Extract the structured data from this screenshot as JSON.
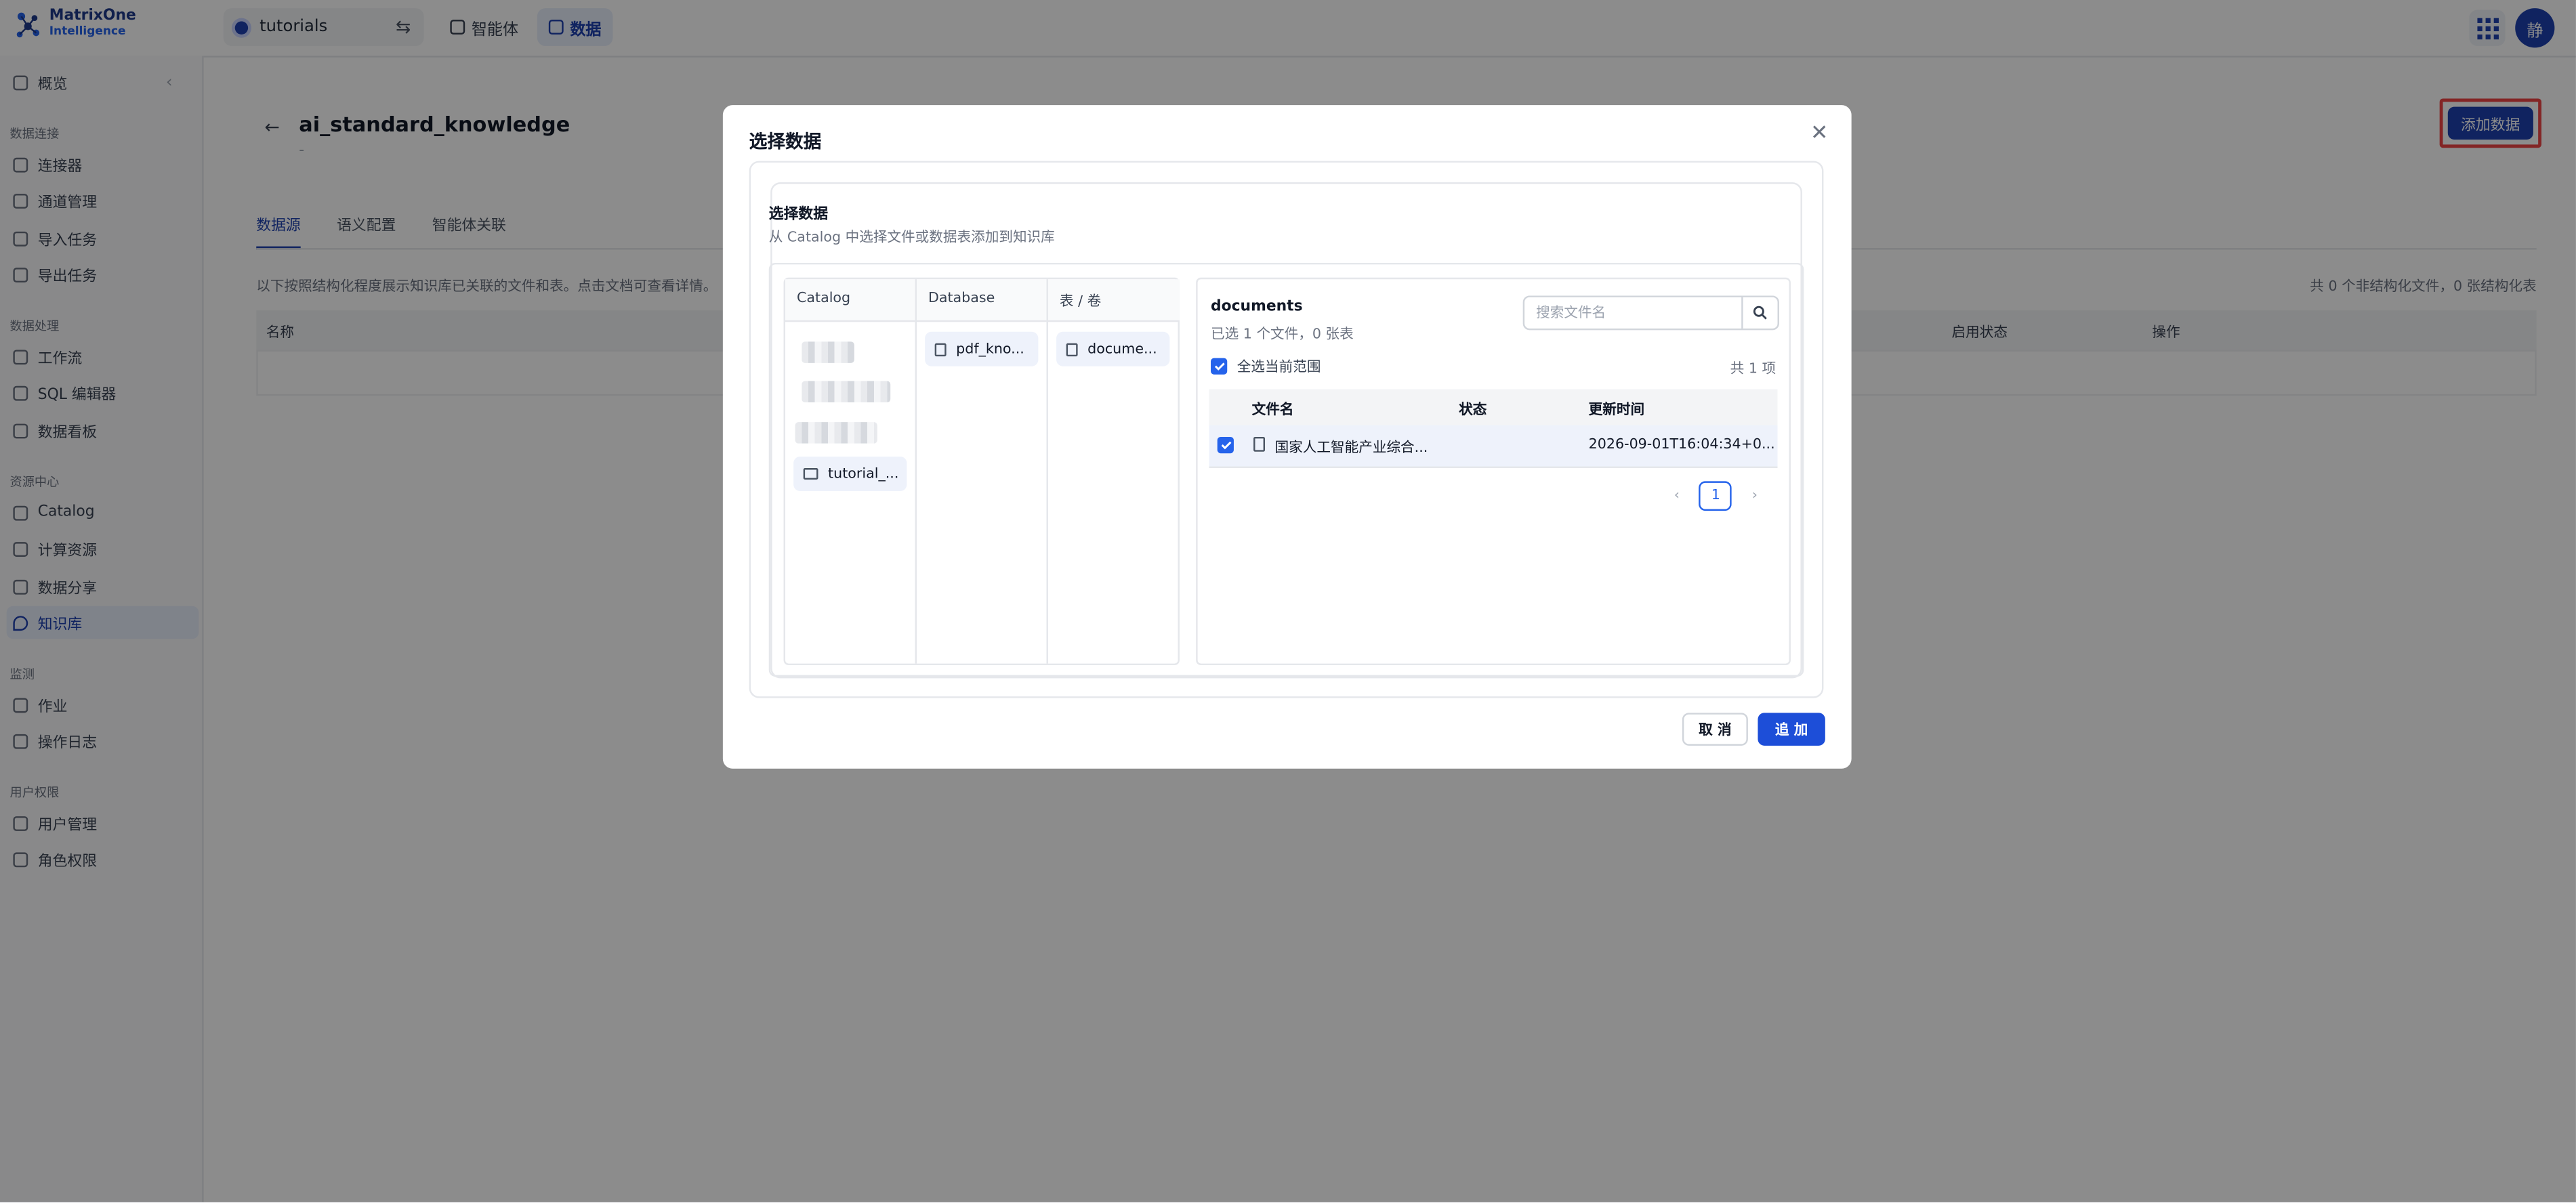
{
  "app": {
    "logo_line1": "MatrixOne",
    "logo_line2": "Intelligence",
    "avatar_initial": "静"
  },
  "topbar": {
    "workspace": "tutorials",
    "nav": [
      {
        "label": "智能体"
      },
      {
        "label": "数据"
      }
    ]
  },
  "sidebar": {
    "overview": "概览",
    "groups": [
      {
        "title": "数据连接",
        "items": [
          "连接器",
          "通道管理",
          "导入任务",
          "导出任务"
        ]
      },
      {
        "title": "数据处理",
        "items": [
          "工作流",
          "SQL 编辑器",
          "数据看板"
        ]
      },
      {
        "title": "资源中心",
        "items": [
          "Catalog",
          "计算资源",
          "数据分享",
          "知识库"
        ]
      },
      {
        "title": "监测",
        "items": [
          "作业",
          "操作日志"
        ]
      },
      {
        "title": "用户权限",
        "items": [
          "用户管理",
          "角色权限"
        ]
      }
    ],
    "active": "知识库"
  },
  "page": {
    "title": "ai_standard_knowledge",
    "subtitle": "-",
    "add_button": "添加数据",
    "tabs": [
      "数据源",
      "语义配置",
      "智能体关联"
    ],
    "description": "以下按照结构化程度展示知识库已关联的文件和表。点击文档可查看详情。",
    "count": "共 0 个非结构化文件，0 张结构化表",
    "table_headers": [
      "名称",
      "启用状态",
      "操作"
    ]
  },
  "modal": {
    "title": "选择数据",
    "section_title": "选择数据",
    "section_sub": "从 Catalog 中选择文件或数据表添加到知识库",
    "columns": {
      "catalog_header": "Catalog",
      "database_header": "Database",
      "table_header": "表 / 卷",
      "catalog_selected": "tutorial_...",
      "database_item": "pdf_kno...",
      "table_item": "docume..."
    },
    "right": {
      "title": "documents",
      "subtitle": "已选 1 个文件，0 张表",
      "search_placeholder": "搜索文件名",
      "select_all": "全选当前范围",
      "total": "共 1 项",
      "headers": [
        "文件名",
        "状态",
        "更新时间"
      ],
      "rows": [
        {
          "name": "国家人工智能产业综合...",
          "status": "",
          "updated": "2026-09-01T16:04:34+0..."
        }
      ],
      "page": "1"
    },
    "cancel": "取 消",
    "ok": "追 加"
  }
}
